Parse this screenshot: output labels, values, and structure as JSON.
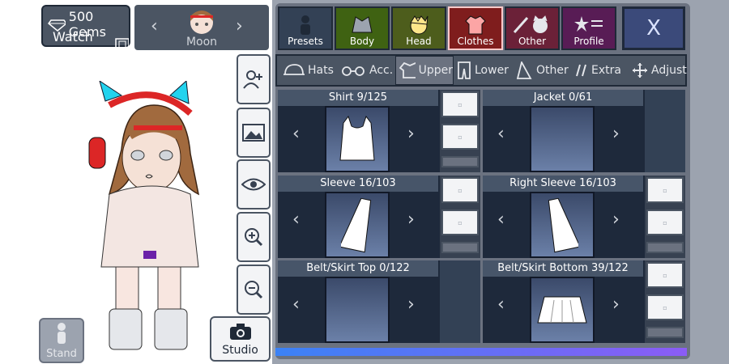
{
  "gems": {
    "label": "500 Gems",
    "watch_ad": "Watch Ad"
  },
  "character": {
    "name": "Moon"
  },
  "left_tools": [
    "add-person-icon",
    "image-icon",
    "eye-icon",
    "zoom-in-icon",
    "zoom-out-icon"
  ],
  "stand_label": "Stand",
  "studio_label": "Studio",
  "category_tabs": [
    {
      "label": "Presets",
      "color": "#334155"
    },
    {
      "label": "Body",
      "color": "#3f6212"
    },
    {
      "label": "Head",
      "color": "#4d5d1c"
    },
    {
      "label": "Clothes",
      "color": "#7f1d1d"
    },
    {
      "label": "Other",
      "color": "#6b2138"
    },
    {
      "label": "Profile",
      "color": "#581c55"
    }
  ],
  "close_label": "X",
  "subtabs": [
    {
      "label": "Hats"
    },
    {
      "label": "Acc."
    },
    {
      "label": "Upper"
    },
    {
      "label": "Lower"
    },
    {
      "label": "Other"
    },
    {
      "label": "Extra"
    },
    {
      "label": "Adjust"
    }
  ],
  "items": [
    {
      "title": "Shirt 9/125"
    },
    {
      "title": "Jacket 0/61"
    },
    {
      "title": "Sleeve 16/103"
    },
    {
      "title": "Right Sleeve 16/103"
    },
    {
      "title": "Belt/Skirt Top 0/122"
    },
    {
      "title": "Belt/Skirt Bottom 39/122"
    }
  ]
}
